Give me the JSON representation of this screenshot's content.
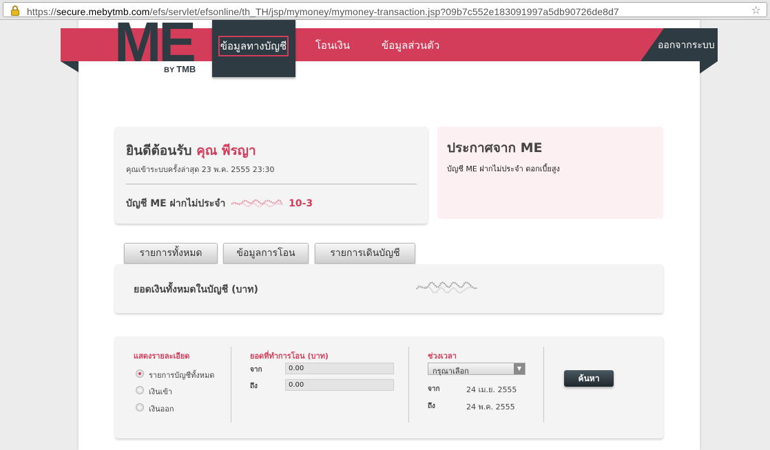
{
  "browser": {
    "url_scheme": "https://",
    "url_domain": "secure.mebytmb.com",
    "url_path": "/efs/servlet/efsonline/th_TH/jsp/mymoney/mymoney-transaction.jsp?09b7c552e183091997a5db90726de8d7"
  },
  "logo": {
    "brand": "ME",
    "by": "BY",
    "bank": "TMB"
  },
  "nav": {
    "account_info": "ข้อมูลทางบัญชี",
    "transfer": "โอนเงิน",
    "personal_info": "ข้อมูลส่วนตัว",
    "logout": "ออกจากระบบ"
  },
  "welcome": {
    "greeting": "ยินดีต้อนรับ",
    "title": "คุณ พีรญา",
    "last_login": "คุณเข้าระบบครั้งล่าสุด 23 พ.ค. 2555 23:30",
    "account_label": "บัญชี ME ฝากไม่ประจำ",
    "account_suffix": "10-3"
  },
  "announcement": {
    "title": "ประกาศจาก ME",
    "text": "บัญชี ME ฝากไม่ประจำ ดอกเบี้ยสูง"
  },
  "tabs": [
    "รายการทั้งหมด",
    "ข้อมูลการโอน",
    "รายการเดินบัญชี"
  ],
  "balance": {
    "label": "ยอดเงินทั้งหมดในบัญชี (บาท)"
  },
  "filter": {
    "show_title": "แสดงรายละเอียด",
    "options": [
      "รายการบัญชีทั้งหมด",
      "เงินเข้า",
      "เงินออก"
    ],
    "amount_title": "ยอดที่ทำการโอน (บาท)",
    "from_label": "จาก",
    "to_label": "ถึง",
    "amount_from": "0.00",
    "amount_to": "0.00",
    "period_title": "ช่วงเวลา",
    "period_select": "กรุณาเลือก",
    "date_from": "24 เม.ย. 2555",
    "date_to": "24 พ.ค. 2555",
    "search": "ค้นหา"
  },
  "colors": {
    "brand_pink": "#d43d5a",
    "brand_dark": "#2f3b42"
  }
}
